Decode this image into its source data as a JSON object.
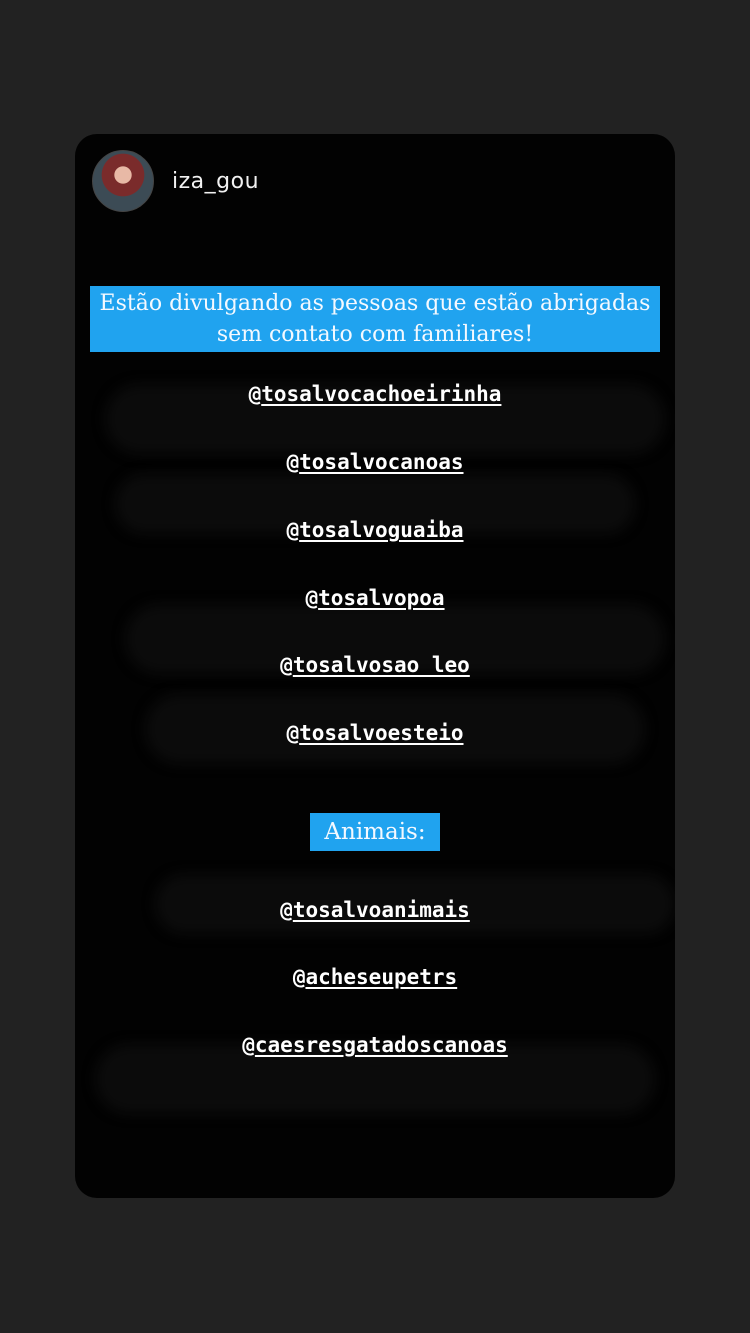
{
  "story": {
    "username": "iza_gou",
    "banner_text": "Estão divulgando as pessoas que estão abrigadas sem contato com familiares!",
    "people_handles": [
      {
        "at": "@",
        "name": "tosalvocachoeirinha"
      },
      {
        "at": "@",
        "name": "tosalvocanoas"
      },
      {
        "at": "@",
        "name": "tosalvoguaiba"
      },
      {
        "at": "@",
        "name": "tosalvopoa"
      },
      {
        "at": "@",
        "name": "tosalvosao_leo"
      },
      {
        "at": "@",
        "name": "tosalvoesteio"
      }
    ],
    "animals_label": "Animais:",
    "animal_handles": [
      {
        "at": "@",
        "name": "tosalvoanimais"
      },
      {
        "at": "@",
        "name": "acheseupetrs"
      },
      {
        "at": "@",
        "name": "caesresgatadoscanoas"
      }
    ]
  },
  "colors": {
    "page_bg": "#222222",
    "card_bg": "#020202",
    "highlight": "#20a3ef",
    "text": "#ffffff"
  }
}
